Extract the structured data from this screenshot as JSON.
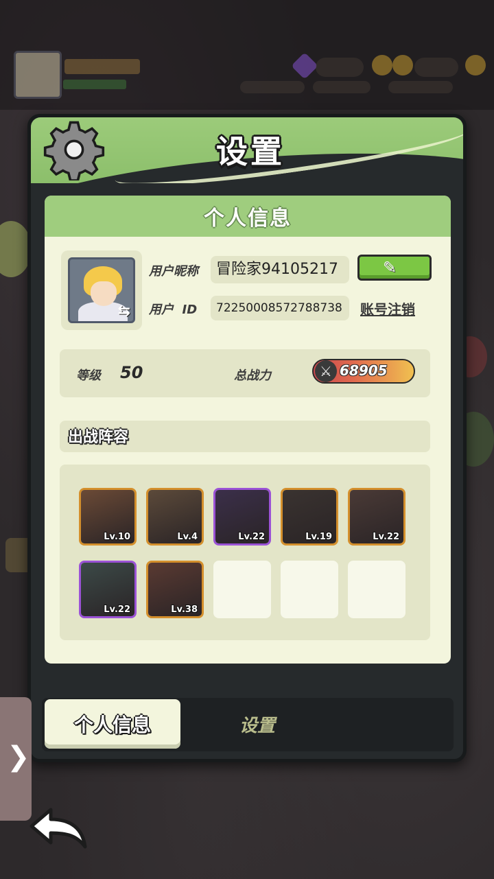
{
  "header": {
    "title": "设置"
  },
  "profile_card": {
    "title": "个人信息",
    "nickname_label": "用户昵称",
    "nickname_value": "冒险家94105217",
    "id_label": "用户  ID",
    "id_value": "72250008572788738",
    "cancel_account": "账号注销"
  },
  "stats": {
    "level_label": "等级",
    "level_value": "50",
    "power_label": "总战力",
    "power_value": "68905"
  },
  "lineup": {
    "title": "出战阵容",
    "heroes": [
      {
        "level": "Lv.10",
        "frame": "gold",
        "color": "#6b4a36"
      },
      {
        "level": "Lv.4",
        "frame": "gold",
        "color": "#5c4a3a"
      },
      {
        "level": "Lv.22",
        "frame": "purple",
        "color": "#3b2f4a"
      },
      {
        "level": "Lv.19",
        "frame": "gold",
        "color": "#3a3330"
      },
      {
        "level": "Lv.22",
        "frame": "gold",
        "color": "#4a3a36"
      },
      {
        "level": "Lv.22",
        "frame": "purple",
        "color": "#3c4a48"
      },
      {
        "level": "Lv.38",
        "frame": "gold",
        "color": "#5a3a32"
      }
    ],
    "empty_slots": 3
  },
  "tabs": {
    "active": "个人信息",
    "inactive": "设置"
  },
  "icons": {
    "gear": "gear-icon",
    "edit": "pencil-icon",
    "swap": "swap-icon",
    "power": "crossed-swords-icon",
    "side_arrow": "chevron-right-icon",
    "back": "back-arrow-icon"
  },
  "side_tab": {
    "glyph": "❯"
  }
}
